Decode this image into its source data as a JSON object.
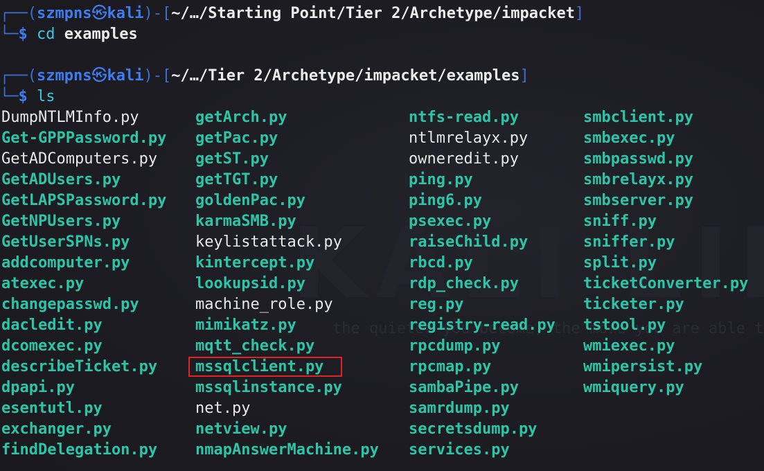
{
  "watermark": {
    "logo_text": "KALI LINUX",
    "tagline": "the quieter you become, the more you are able to hear"
  },
  "prompt1": {
    "box_start": "┌──(",
    "user": "szmpns",
    "skull": "㉿",
    "host": "kali",
    "box_mid": ")-[",
    "path": "~/…/Starting Point/Tier 2/Archetype/impacket",
    "box_end": "]",
    "box_bottom": "└─",
    "dollar": "$",
    "command": "cd",
    "argument": "examples"
  },
  "prompt2": {
    "box_start": "┌──(",
    "user": "szmpns",
    "skull": "㉿",
    "host": "kali",
    "box_mid": ")-[",
    "path": "~/…/Tier 2/Archetype/impacket/examples",
    "box_end": "]",
    "box_bottom": "└─",
    "dollar": "$",
    "command": "ls"
  },
  "listing": {
    "col1": [
      {
        "name": "DumpNTLMInfo.py",
        "exec": false
      },
      {
        "name": "Get-GPPPassword.py",
        "exec": true
      },
      {
        "name": "GetADComputers.py",
        "exec": false
      },
      {
        "name": "GetADUsers.py",
        "exec": true
      },
      {
        "name": "GetLAPSPassword.py",
        "exec": true
      },
      {
        "name": "GetNPUsers.py",
        "exec": true
      },
      {
        "name": "GetUserSPNs.py",
        "exec": true
      },
      {
        "name": "addcomputer.py",
        "exec": true
      },
      {
        "name": "atexec.py",
        "exec": true
      },
      {
        "name": "changepasswd.py",
        "exec": true
      },
      {
        "name": "dacledit.py",
        "exec": true
      },
      {
        "name": "dcomexec.py",
        "exec": true
      },
      {
        "name": "describeTicket.py",
        "exec": true
      },
      {
        "name": "dpapi.py",
        "exec": true
      },
      {
        "name": "esentutl.py",
        "exec": true
      },
      {
        "name": "exchanger.py",
        "exec": true
      },
      {
        "name": "findDelegation.py",
        "exec": true
      }
    ],
    "col2": [
      {
        "name": "getArch.py",
        "exec": true
      },
      {
        "name": "getPac.py",
        "exec": true
      },
      {
        "name": "getST.py",
        "exec": true
      },
      {
        "name": "getTGT.py",
        "exec": true
      },
      {
        "name": "goldenPac.py",
        "exec": true
      },
      {
        "name": "karmaSMB.py",
        "exec": true
      },
      {
        "name": "keylistattack.py",
        "exec": false
      },
      {
        "name": "kintercept.py",
        "exec": true
      },
      {
        "name": "lookupsid.py",
        "exec": true
      },
      {
        "name": "machine_role.py",
        "exec": false
      },
      {
        "name": "mimikatz.py",
        "exec": true
      },
      {
        "name": "mqtt_check.py",
        "exec": true
      },
      {
        "name": "mssqlclient.py",
        "exec": true
      },
      {
        "name": "mssqlinstance.py",
        "exec": true
      },
      {
        "name": "net.py",
        "exec": false
      },
      {
        "name": "netview.py",
        "exec": true
      },
      {
        "name": "nmapAnswerMachine.py",
        "exec": true
      }
    ],
    "col3": [
      {
        "name": "ntfs-read.py",
        "exec": true
      },
      {
        "name": "ntlmrelayx.py",
        "exec": false
      },
      {
        "name": "owneredit.py",
        "exec": false
      },
      {
        "name": "ping.py",
        "exec": true
      },
      {
        "name": "ping6.py",
        "exec": true
      },
      {
        "name": "psexec.py",
        "exec": true
      },
      {
        "name": "raiseChild.py",
        "exec": true
      },
      {
        "name": "rbcd.py",
        "exec": true
      },
      {
        "name": "rdp_check.py",
        "exec": true
      },
      {
        "name": "reg.py",
        "exec": true
      },
      {
        "name": "registry-read.py",
        "exec": true
      },
      {
        "name": "rpcdump.py",
        "exec": true
      },
      {
        "name": "rpcmap.py",
        "exec": true
      },
      {
        "name": "sambaPipe.py",
        "exec": true
      },
      {
        "name": "samrdump.py",
        "exec": true
      },
      {
        "name": "secretsdump.py",
        "exec": true
      },
      {
        "name": "services.py",
        "exec": true
      }
    ],
    "col4": [
      {
        "name": "smbclient.py",
        "exec": true
      },
      {
        "name": "smbexec.py",
        "exec": true
      },
      {
        "name": "smbpasswd.py",
        "exec": true
      },
      {
        "name": "smbrelayx.py",
        "exec": true
      },
      {
        "name": "smbserver.py",
        "exec": true
      },
      {
        "name": "sniff.py",
        "exec": true
      },
      {
        "name": "sniffer.py",
        "exec": true
      },
      {
        "name": "split.py",
        "exec": true
      },
      {
        "name": "ticketConverter.py",
        "exec": true
      },
      {
        "name": "ticketer.py",
        "exec": true
      },
      {
        "name": "tstool.py",
        "exec": true
      },
      {
        "name": "wmiexec.py",
        "exec": true
      },
      {
        "name": "wmipersist.py",
        "exec": true
      },
      {
        "name": "wmiquery.py",
        "exec": true
      }
    ]
  },
  "highlighted_file": "mssqlclient.py",
  "colors": {
    "background": "#1c1c22",
    "executable": "#2ec4a8",
    "plain_file": "#e8e8e8",
    "prompt_blue": "#3d7df0",
    "highlight_box": "#e02424"
  }
}
